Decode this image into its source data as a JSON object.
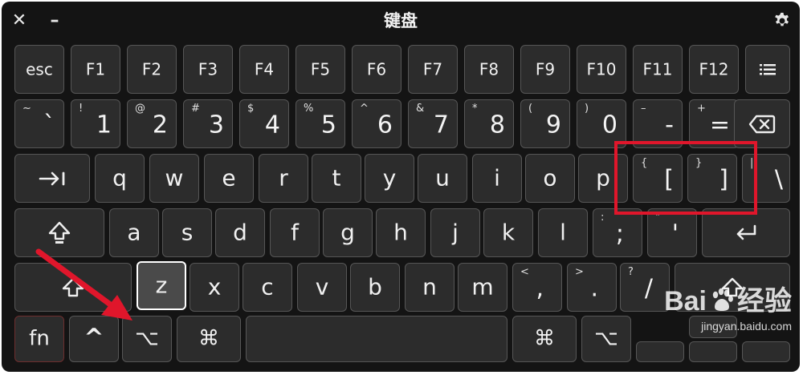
{
  "window": {
    "title": "键盘",
    "close_symbol": "✕",
    "minimize_symbol": "–",
    "settings_icon": "gear-icon"
  },
  "rows": {
    "row1": [
      "esc",
      "F1",
      "F2",
      "F3",
      "F4",
      "F5",
      "F6",
      "F7",
      "F8",
      "F9",
      "F10",
      "F11",
      "F12"
    ],
    "row1_menu_icon": "list-icon",
    "row2": [
      {
        "shift": "~",
        "main": "`"
      },
      {
        "shift": "!",
        "main": "1"
      },
      {
        "shift": "@",
        "main": "2"
      },
      {
        "shift": "#",
        "main": "3"
      },
      {
        "shift": "$",
        "main": "4"
      },
      {
        "shift": "%",
        "main": "5"
      },
      {
        "shift": "^",
        "main": "6"
      },
      {
        "shift": "&",
        "main": "7"
      },
      {
        "shift": "*",
        "main": "8"
      },
      {
        "shift": "(",
        "main": "9"
      },
      {
        "shift": ")",
        "main": "0"
      },
      {
        "shift": "–",
        "main": "-"
      },
      {
        "shift": "+",
        "main": "="
      }
    ],
    "row3": [
      "q",
      "w",
      "e",
      "r",
      "t",
      "y",
      "u",
      "i",
      "o",
      "p"
    ],
    "row3_brackets": [
      {
        "shift": "{",
        "main": "["
      },
      {
        "shift": "}",
        "main": "]"
      },
      {
        "shift": "|",
        "main": "\\"
      }
    ],
    "row4": [
      "a",
      "s",
      "d",
      "f",
      "g",
      "h",
      "j",
      "k",
      "l"
    ],
    "row4_punct": [
      {
        "shift": ":",
        "main": ";"
      },
      {
        "shift": "\"",
        "main": "'"
      }
    ],
    "row5": [
      "z",
      "x",
      "c",
      "v",
      "b",
      "n",
      "m"
    ],
    "row5_punct": [
      {
        "shift": "<",
        "main": ","
      },
      {
        "shift": ">",
        "main": "."
      },
      {
        "shift": "?",
        "main": "/"
      }
    ],
    "row6": {
      "fn": "fn",
      "control": "^",
      "option": "⌥",
      "command": "⌘",
      "command_right": "⌘",
      "option_right": "⌥"
    }
  },
  "selected_key": "z",
  "annotation": {
    "highlight_color": "#e0162b",
    "arrow_color": "#e0162b"
  },
  "watermark": {
    "logo_left": "Bai",
    "logo_right": "经验",
    "url": "jingyan.baidu.com"
  }
}
